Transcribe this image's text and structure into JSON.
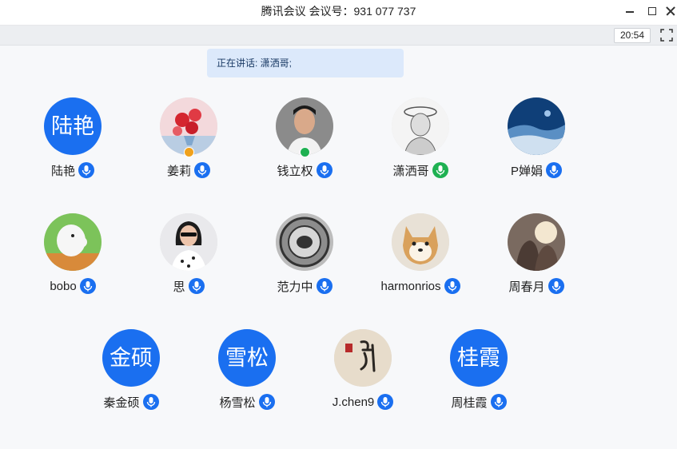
{
  "window": {
    "title": "腾讯会议 会议号：931 077 737"
  },
  "toolbar": {
    "clock": "20:54"
  },
  "speaking": {
    "text": "正在讲话: 潇洒哥;"
  },
  "participants": [
    {
      "name": "陆艳",
      "avatar_text": "陆艳",
      "mic": "blue"
    },
    {
      "name": "姜莉",
      "avatar_icon": "roses-photo",
      "badge": "orange",
      "mic": "blue"
    },
    {
      "name": "钱立权",
      "avatar_icon": "man-portrait-photo",
      "badge": "green",
      "mic": "blue"
    },
    {
      "name": "潇洒哥",
      "avatar_icon": "sketch-portrait-photo",
      "mic": "green"
    },
    {
      "name": "P婵娟",
      "avatar_icon": "snowy-landscape-photo",
      "mic": "blue"
    },
    {
      "name": "bobo",
      "avatar_icon": "moomin-photo",
      "mic": "blue"
    },
    {
      "name": "思",
      "avatar_icon": "woman-sunglasses-photo",
      "mic": "blue"
    },
    {
      "name": "范力中",
      "avatar_icon": "coin-photo",
      "mic": "blue"
    },
    {
      "name": "harmonrios",
      "avatar_icon": "shiba-dog-photo",
      "mic": "blue"
    },
    {
      "name": "周春月",
      "avatar_icon": "sunset-couple-photo",
      "mic": "blue"
    },
    {
      "name": "秦金硕",
      "avatar_text": "金硕",
      "mic": "blue"
    },
    {
      "name": "杨雪松",
      "avatar_text": "雪松",
      "mic": "blue"
    },
    {
      "name": "J.chen9",
      "avatar_icon": "calligraphy-photo",
      "mic": "blue"
    },
    {
      "name": "周桂霞",
      "avatar_text": "桂霞",
      "mic": "blue"
    }
  ],
  "colors": {
    "avatar_blue": "#1a6ff0",
    "mic_blue": "#1a6ff0",
    "mic_green": "#1fb152",
    "badge_green": "#1fb152",
    "badge_orange": "#f0a11c",
    "speaking_bg": "#dce9fb"
  }
}
